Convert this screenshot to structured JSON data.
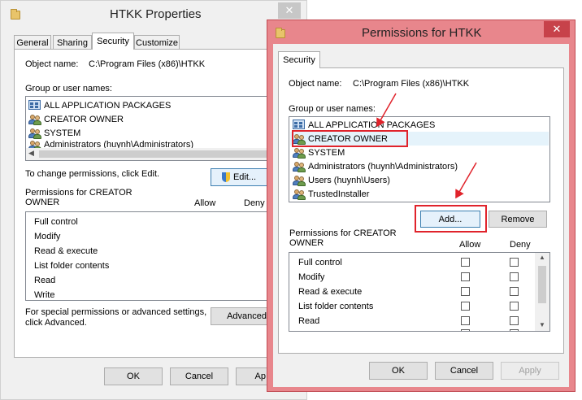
{
  "back_window": {
    "title": "HTKK Properties",
    "close_glyph": "✕",
    "tabs": [
      {
        "label": "General"
      },
      {
        "label": "Sharing"
      },
      {
        "label": "Security"
      },
      {
        "label": "Customize"
      }
    ],
    "object_name_label": "Object name:",
    "object_name_value": "C:\\Program Files (x86)\\HTKK",
    "group_label": "Group or user names:",
    "users": [
      {
        "name": "ALL APPLICATION PACKAGES",
        "icon": "packages-icon"
      },
      {
        "name": "CREATOR OWNER",
        "icon": "users-icon"
      },
      {
        "name": "SYSTEM",
        "icon": "users-icon"
      },
      {
        "name": "Administrators (huynh\\Administrators)",
        "icon": "users-icon"
      }
    ],
    "change_text": "To change permissions, click Edit.",
    "edit_label": "Edit...",
    "perm_for_line1": "Permissions for CREATOR",
    "perm_for_line2": "OWNER",
    "allow_header": "Allow",
    "deny_header": "Deny",
    "permissions": [
      "Full control",
      "Modify",
      "Read & execute",
      "List folder contents",
      "Read",
      "Write"
    ],
    "special_line1": "For special permissions or advanced settings,",
    "special_line2": "click Advanced.",
    "advanced_label": "Advanced",
    "ok_label": "OK",
    "cancel_label": "Cancel",
    "apply_label": "Ap"
  },
  "front_window": {
    "title": "Permissions for HTKK",
    "close_glyph": "✕",
    "tab_label": "Security",
    "object_name_label": "Object name:",
    "object_name_value": "C:\\Program Files (x86)\\HTKK",
    "group_label": "Group or user names:",
    "users": [
      {
        "name": "ALL APPLICATION PACKAGES",
        "icon": "packages-icon"
      },
      {
        "name": "CREATOR OWNER",
        "icon": "users-icon"
      },
      {
        "name": "SYSTEM",
        "icon": "users-icon"
      },
      {
        "name": "Administrators (huynh\\Administrators)",
        "icon": "users-icon"
      },
      {
        "name": "Users (huynh\\Users)",
        "icon": "users-icon"
      },
      {
        "name": "TrustedInstaller",
        "icon": "users-icon"
      }
    ],
    "add_label": "Add...",
    "remove_label": "Remove",
    "perm_for_line1": "Permissions for CREATOR",
    "perm_for_line2": "OWNER",
    "allow_header": "Allow",
    "deny_header": "Deny",
    "permissions": [
      "Full control",
      "Modify",
      "Read & execute",
      "List folder contents",
      "Read"
    ],
    "ok_label": "OK",
    "cancel_label": "Cancel",
    "apply_label": "Apply"
  },
  "colors": {
    "front_frame": "#e8868c",
    "back_frame": "#f0f0f0",
    "annotation_red": "#e0232b",
    "selection": "#e5f3fb"
  }
}
